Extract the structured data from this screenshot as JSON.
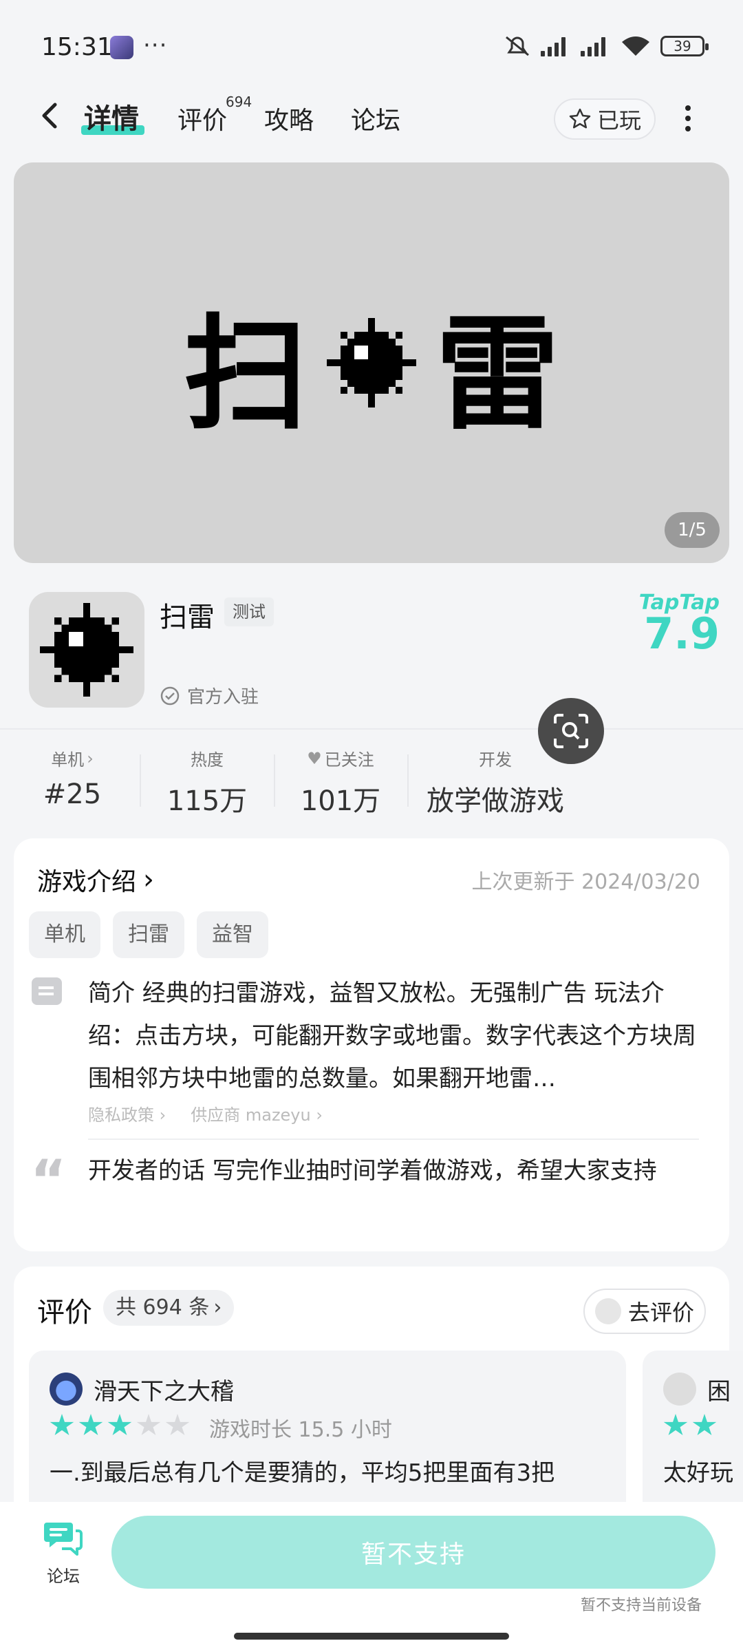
{
  "status_bar": {
    "time": "15:31",
    "dots": "···",
    "battery": "39"
  },
  "nav": {
    "tabs": [
      {
        "label": "详情"
      },
      {
        "label": "评价"
      },
      {
        "label": "攻略"
      },
      {
        "label": "论坛"
      }
    ],
    "review_badge": "694",
    "played_label": "已玩"
  },
  "banner": {
    "title_left": "扫",
    "title_right": "雷",
    "page_indicator": "1/5"
  },
  "app": {
    "name": "扫雷",
    "tag": "测试",
    "official": "官方入驻",
    "platform_logo": "TapTap",
    "score": "7.9"
  },
  "stats": [
    {
      "label": "单机",
      "value": "#25"
    },
    {
      "label": "热度",
      "value": "115万"
    },
    {
      "label": "已关注",
      "value": "101万"
    },
    {
      "label": "开发",
      "value": "放学做游戏"
    }
  ],
  "intro": {
    "title": "游戏介绍",
    "update_time": "上次更新于 2024/03/20",
    "tags": [
      "单机",
      "扫雷",
      "益智"
    ],
    "summary": "简介 经典的扫雷游戏，益智又放松。无强制广告 玩法介绍：点击方块，可能翻开数字或地雷。数字代表这个方块周围相邻方块中地雷的总数量。如果翻开地雷…",
    "privacy_link": "隐私政策",
    "provider_link": "供应商 mazeyu",
    "developer_words": "开发者的话 写完作业抽时间学着做游戏，希望大家支持"
  },
  "reviews": {
    "title": "评价",
    "count_label": "共 694 条",
    "go_review": "去评价",
    "items": [
      {
        "user": "滑天下之大稽",
        "rating": 3,
        "play_time": "游戏时长 15.5 小时",
        "text": "一.到最后总有几个是要猜的，平均5把里面有3把"
      },
      {
        "user": "困",
        "rating": 2,
        "text": "太好玩"
      }
    ]
  },
  "bottom": {
    "forum_label": "论坛",
    "main_button": "暂不支持",
    "hint": "暂不支持当前设备"
  },
  "colors": {
    "accent": "#3fd6c2",
    "button_disabled": "#a3e9df"
  }
}
